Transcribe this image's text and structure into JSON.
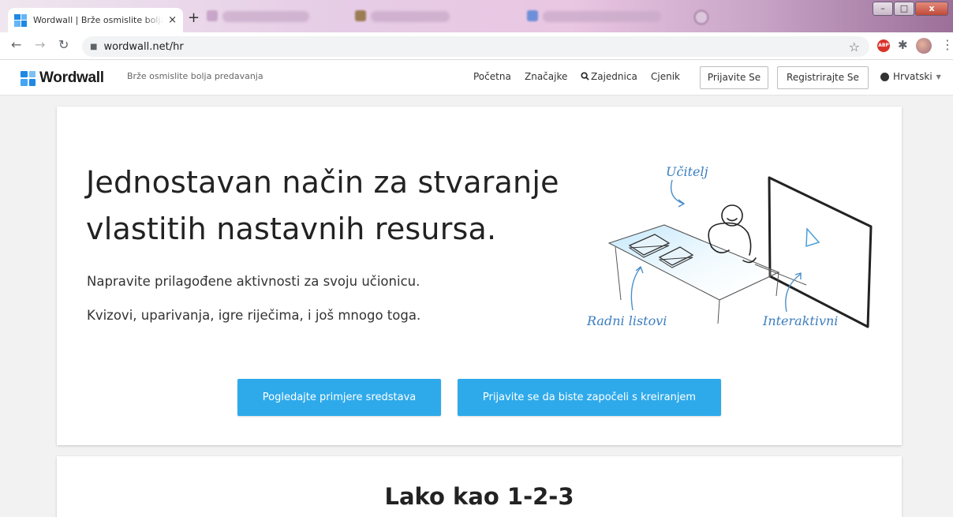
{
  "browser": {
    "active_tab_title": "Wordwall | Brže osmislite bolja predavanja",
    "tab_close": "×",
    "new_tab": "+",
    "url": "wordwall.net/hr",
    "window_controls": [
      "–",
      "□",
      "x"
    ]
  },
  "header": {
    "logo_text": "Wordwall",
    "tagline": "Brže osmislite bolja predavanja",
    "nav": {
      "home": "Početna",
      "features": "Značajke",
      "community": "Zajednica",
      "pricing": "Cjenik"
    },
    "login_button": "Prijavite Se",
    "register_button": "Registrirajte Se",
    "language": "Hrvatski"
  },
  "hero": {
    "title": "Jednostavan način za stvaranje vlastitih nastavnih resursa.",
    "line1": "Napravite prilagođene aktivnosti za svoju učionicu.",
    "line2": "Kvizovi, uparivanja, igre riječima, i još mnogo toga.",
    "illustration": {
      "teacher_label": "Učitelj",
      "worksheets_label": "Radni listovi",
      "interactive_label": "Interaktivni"
    },
    "cta_examples": "Pogledajte primjere sredstava",
    "cta_login": "Prijavite se da biste započeli s kreiranjem"
  },
  "section2": {
    "title": "Lako kao 1-2-3"
  },
  "colors": {
    "accent": "#2eaaeb",
    "brand_blue": "#1e88e5",
    "page_bg": "#f2f2f2"
  }
}
